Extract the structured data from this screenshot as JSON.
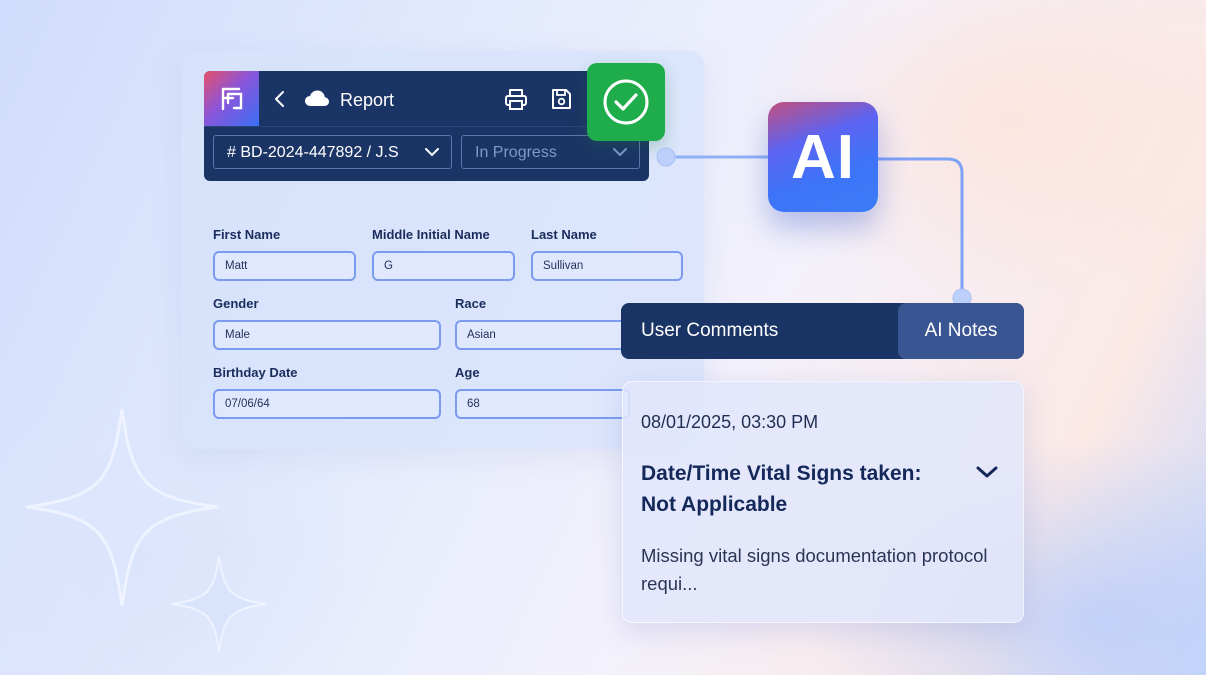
{
  "header": {
    "title": "Report",
    "icons": [
      "app-logo-icon",
      "back-icon",
      "cloud-icon",
      "print-icon",
      "save-icon"
    ],
    "record_select": "# BD-2024-447892 / J.S",
    "status_select": "In Progress"
  },
  "form": {
    "first_name": {
      "label": "First Name",
      "value": "Matt"
    },
    "middle_name": {
      "label": "Middle Initial Name",
      "value": "G"
    },
    "last_name": {
      "label": "Last Name",
      "value": "Sullivan"
    },
    "gender": {
      "label": "Gender",
      "value": "Male"
    },
    "race": {
      "label": "Race",
      "value": "Asian"
    },
    "birthday": {
      "label": "Birthday Date",
      "value": "07/06/64"
    },
    "age": {
      "label": "Age",
      "value": "68"
    }
  },
  "ai_badge": "AI",
  "tabs": {
    "user_comments": "User Comments",
    "ai_notes": "AI Notes"
  },
  "note": {
    "timestamp": "08/01/2025, 03:30 PM",
    "heading": "Date/Time Vital Signs taken: Not Applicable",
    "body": "Missing vital signs documentation protocol requi..."
  },
  "colors": {
    "header_bg": "#1b3466",
    "check_green": "#1fad4c",
    "ai_blue": "#3b7cf9",
    "field_border": "#7b9bf0"
  }
}
